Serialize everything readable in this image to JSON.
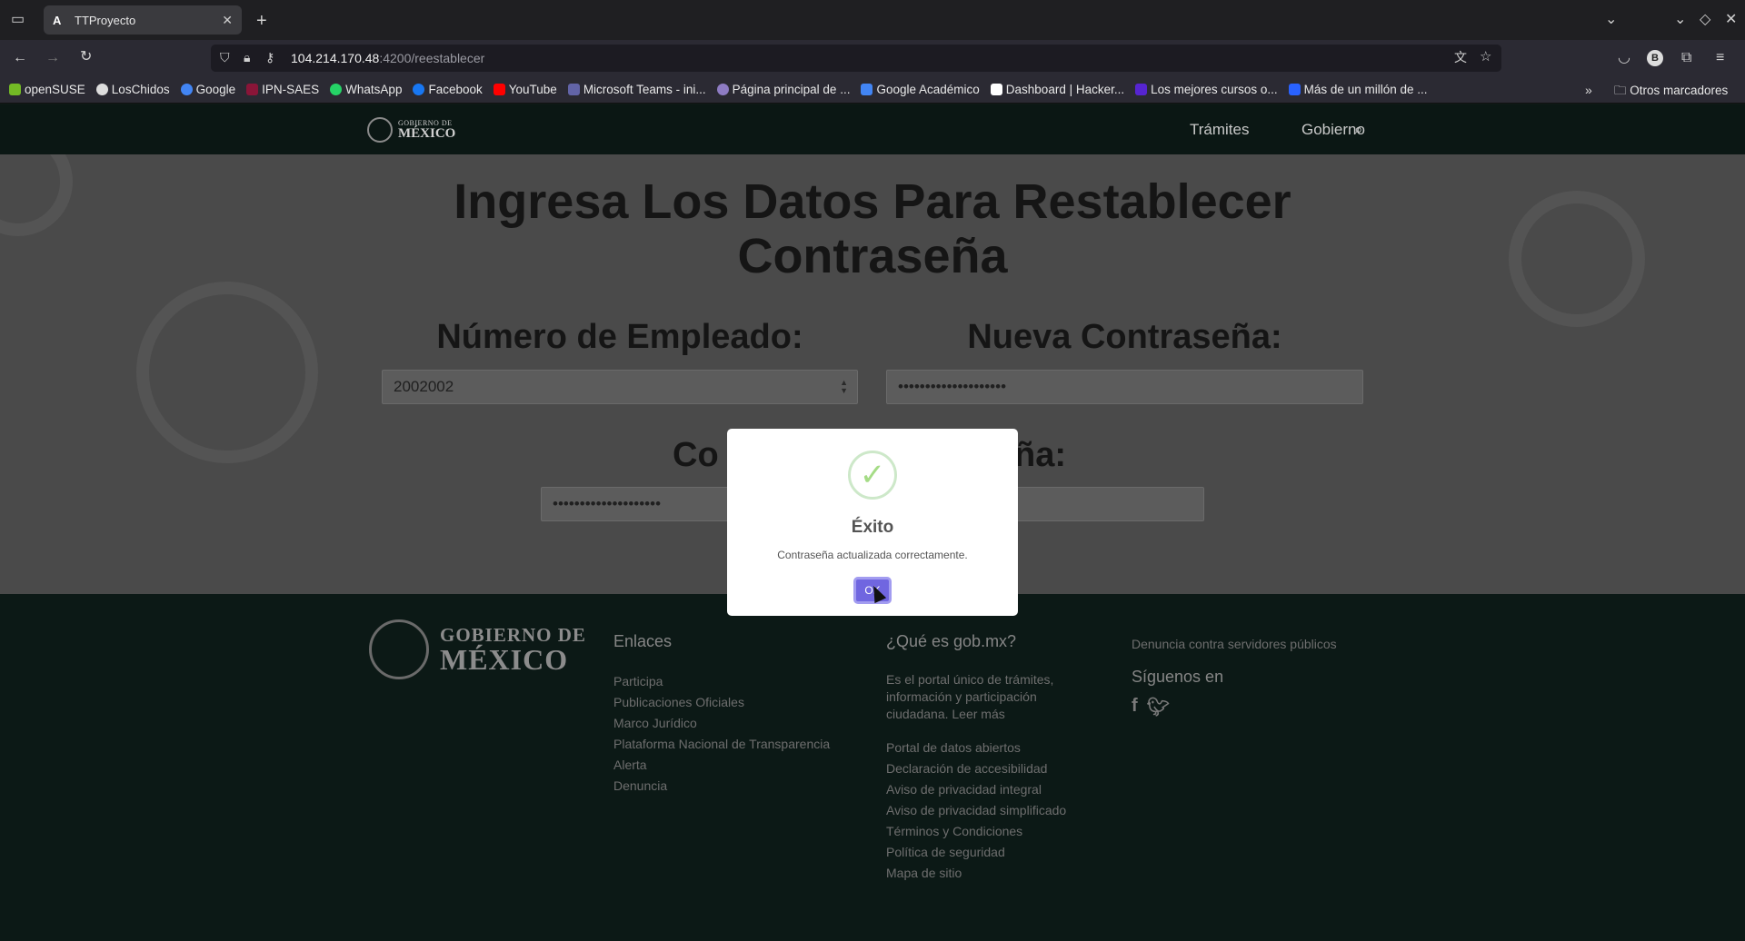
{
  "browser": {
    "tab_title": "TTProyecto",
    "tab_favicon": "A",
    "url_host": "104.214.170.48",
    "url_path": ":4200/reestablecer",
    "bookmarks": [
      {
        "label": "openSUSE",
        "color": "#73ba25"
      },
      {
        "label": "LosChidos",
        "color": "#dddddd"
      },
      {
        "label": "Google",
        "color": "#4285f4"
      },
      {
        "label": "IPN-SAES",
        "color": "#8a1538"
      },
      {
        "label": "WhatsApp",
        "color": "#25d366"
      },
      {
        "label": "Facebook",
        "color": "#1877f2"
      },
      {
        "label": "YouTube",
        "color": "#ff0000"
      },
      {
        "label": "Microsoft Teams - ini...",
        "color": "#6264a7"
      },
      {
        "label": "Página principal de ...",
        "color": "#8e7cc3"
      },
      {
        "label": "Google Académico",
        "color": "#4285f4"
      },
      {
        "label": "Dashboard | Hacker...",
        "color": "#ffffff"
      },
      {
        "label": "Los mejores cursos o...",
        "color": "#5624d0"
      },
      {
        "label": "Más de un millón de ...",
        "color": "#2962ff"
      }
    ],
    "other_bookmarks": "Otros marcadores"
  },
  "header": {
    "logo_line1": "GOBIERNO DE",
    "logo_line2": "MÉXICO",
    "nav_tramites": "Trámites",
    "nav_gobierno": "Gobierno"
  },
  "form": {
    "title_line1": "Ingresa Los Datos Para Restablecer",
    "title_line2": "Contraseña",
    "employee_label": "Número de Empleado:",
    "employee_value": "2002002",
    "new_password_label": "Nueva Contraseña:",
    "new_password_value": "••••••••••••••••••••",
    "confirm_label_left": "Co",
    "confirm_label_right": "ña:",
    "confirm_value": "••••••••••••••••••••"
  },
  "modal": {
    "title": "Éxito",
    "message": "Contraseña actualizada correctamente.",
    "ok_label": "OK"
  },
  "footer": {
    "logo_line1": "GOBIERNO DE",
    "logo_line2": "MÉXICO",
    "enlaces_heading": "Enlaces",
    "enlaces": [
      "Participa",
      "Publicaciones Oficiales",
      "Marco Jurídico",
      "Plataforma Nacional de Transparencia",
      "Alerta",
      "Denuncia"
    ],
    "que_es_heading": "¿Qué es gob.mx?",
    "que_es_desc": "Es el portal único de trámites, información y participación ciudadana. Leer más",
    "que_es_links": [
      "Portal de datos abiertos",
      "Declaración de accesibilidad",
      "Aviso de privacidad integral",
      "Aviso de privacidad simplificado",
      "Términos y Condiciones",
      "Política de seguridad",
      "Mapa de sitio"
    ],
    "denuncia": "Denuncia contra servidores públicos",
    "siguenos": "Síguenos en"
  }
}
